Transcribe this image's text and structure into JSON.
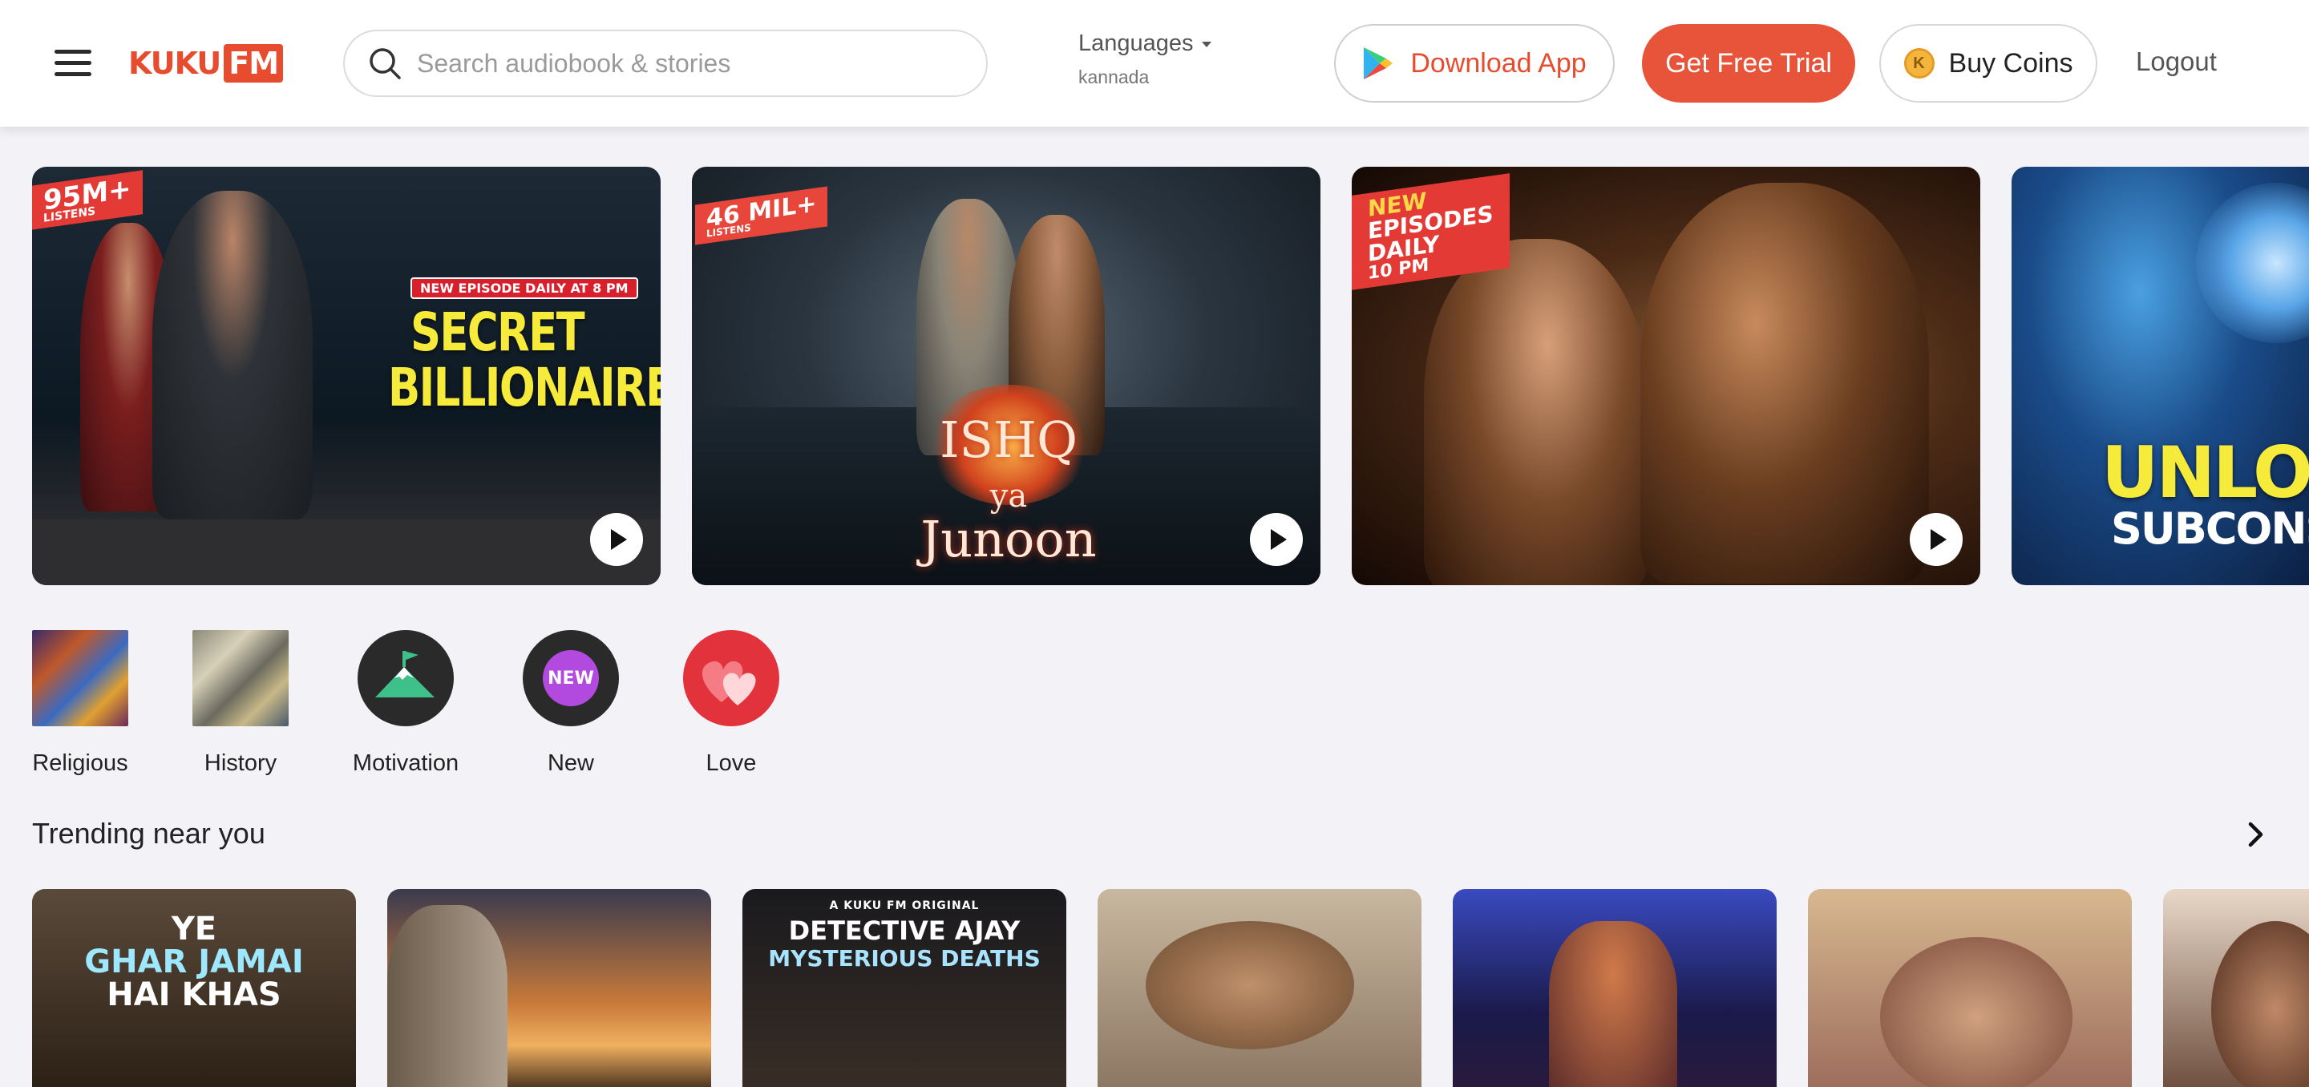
{
  "header": {
    "logo_text": "KUKU",
    "logo_fm": "FM",
    "search_placeholder": "Search audiobook & stories",
    "languages_label": "Languages",
    "language_value": "kannada",
    "download_label": "Download App",
    "trial_label": "Get Free Trial",
    "coins_label": "Buy Coins",
    "coin_glyph": "K",
    "logout_label": "Logout"
  },
  "banners": [
    {
      "badge": "95M+",
      "badge_sub": "LISTENS",
      "tag": "NEW EPISODE DAILY AT 8 PM",
      "title_line1": "SECRET",
      "title_line2": "BILLIONAIRE"
    },
    {
      "badge": "46 MIL+",
      "badge_sub": "LISTENS",
      "title_line1": "ISHQ",
      "title_line2": "ya",
      "title_line3": "Junoon"
    },
    {
      "badge_line1": "NEW",
      "badge_line2": "EPISODES",
      "badge_line3": "DAILY",
      "badge_time": "10 PM"
    },
    {
      "title_line1": "UNLOC",
      "title_line2": "SUBCONSC"
    }
  ],
  "categories": [
    {
      "label": "Religious",
      "icon": "religious-art-icon"
    },
    {
      "label": "History",
      "icon": "history-collage-icon"
    },
    {
      "label": "Motivation",
      "icon": "mountain-flag-icon"
    },
    {
      "label": "New",
      "icon": "new-badge-icon",
      "badge_text": "NEW"
    },
    {
      "label": "Love",
      "icon": "hearts-icon"
    }
  ],
  "trending": {
    "title": "Trending near you",
    "cards": [
      {
        "line1": "YE",
        "line2": "GHAR JAMAI",
        "line3": "HAI KHAS"
      },
      {
        "line1": ""
      },
      {
        "kicker": "A KUKU FM ORIGINAL",
        "line1": "DETECTIVE AJAY",
        "line2": "MYSTERIOUS DEATHS"
      },
      {
        "line1": ""
      },
      {
        "line1": ""
      },
      {
        "line1": ""
      },
      {
        "line1": ""
      }
    ]
  },
  "colors": {
    "brand": "#e84c2e",
    "trial_bg": "#e8543a",
    "page_bg": "#f3f2f6"
  }
}
